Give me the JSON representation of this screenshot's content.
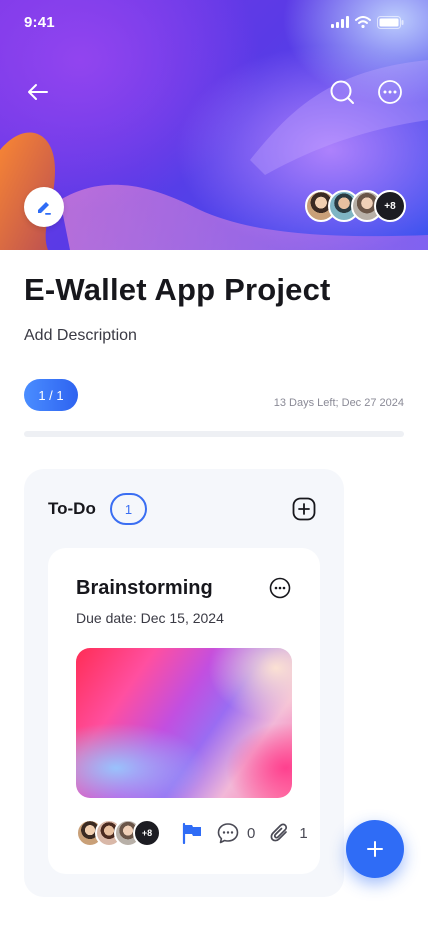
{
  "status_bar": {
    "time": "9:41"
  },
  "hero": {
    "avatar_more_label": "+8"
  },
  "project": {
    "title": "E-Wallet App Project",
    "description_placeholder": "Add Description",
    "task_count_pill": "1 / 1",
    "days_left": "13 Days Left; Dec 27 2024"
  },
  "column": {
    "title": "To-Do",
    "count": "1"
  },
  "task_card": {
    "title": "Brainstorming",
    "due_date": "Due date: Dec 15, 2024",
    "avatar_more_label": "+8",
    "comment_count": "0",
    "attachment_count": "1"
  },
  "colors": {
    "accent": "#2f6cf6",
    "pill_gradient_start": "#4a8dff",
    "column_bg": "#f5f7fb"
  },
  "icons": {
    "back": "arrow-left-icon",
    "search": "search-icon",
    "more": "more-horizontal-icon",
    "edit": "pencil-icon",
    "add": "plus-square-icon",
    "flag": "flag-icon",
    "comment": "chat-bubble-icon",
    "attachment": "paperclip-icon",
    "fab": "plus-icon"
  }
}
